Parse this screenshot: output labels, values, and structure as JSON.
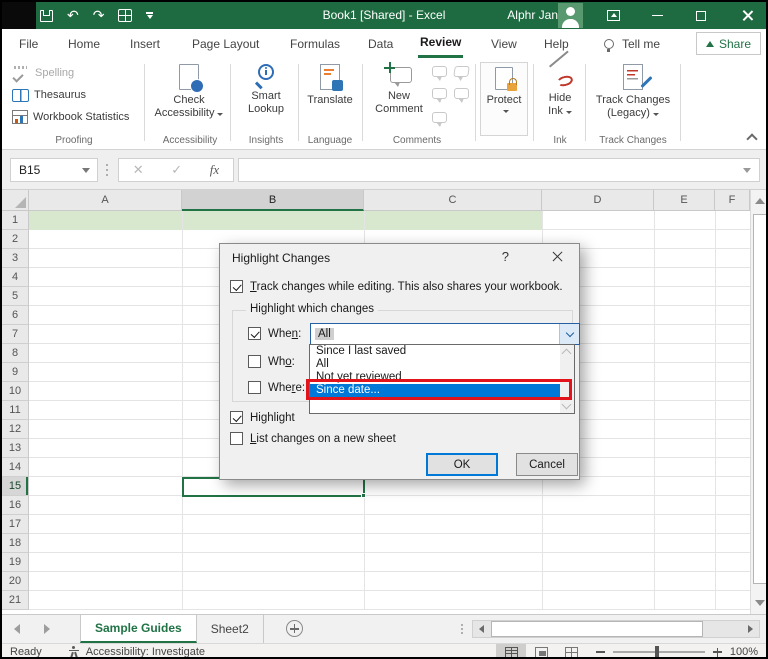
{
  "titlebar": {
    "title": "Book1  [Shared]  -  Excel",
    "user": "Alphr Jan"
  },
  "icons": {
    "undo": "↶",
    "redo": "↷",
    "formula_cancel": "✕",
    "formula_enter": "✓",
    "fx": "fx",
    "dialog_help": "?"
  },
  "ribbon": {
    "tabs": [
      {
        "label": "File"
      },
      {
        "label": "Home"
      },
      {
        "label": "Insert"
      },
      {
        "label": "Page Layout"
      },
      {
        "label": "Formulas"
      },
      {
        "label": "Data"
      },
      {
        "label": "Review",
        "active": true
      },
      {
        "label": "View"
      },
      {
        "label": "Help"
      }
    ],
    "tellme_label": "Tell me",
    "share_label": "Share",
    "groups": {
      "proofing": {
        "label": "Proofing",
        "spelling": "Spelling",
        "thesaurus": "Thesaurus",
        "workbook_statistics": "Workbook Statistics"
      },
      "accessibility": {
        "label": "Accessibility",
        "line1": "Check",
        "line2": "Accessibility"
      },
      "insights": {
        "label": "Insights",
        "line1": "Smart",
        "line2": "Lookup"
      },
      "language": {
        "label": "Language",
        "line1": "Translate"
      },
      "comments": {
        "label": "Comments",
        "line1": "New",
        "line2": "Comment"
      },
      "protect": {
        "line1": "Protect"
      },
      "ink": {
        "label": "Ink",
        "line1": "Hide",
        "line2": "Ink"
      },
      "track_changes": {
        "label": "Track Changes",
        "line1": "Track Changes",
        "line2": "(Legacy)"
      }
    }
  },
  "formula_bar": {
    "name_box": "B15"
  },
  "grid": {
    "columns": [
      "A",
      "B",
      "C",
      "D",
      "E",
      "F"
    ],
    "rows": [
      "1",
      "2",
      "3",
      "4",
      "5",
      "6",
      "7",
      "8",
      "9",
      "10",
      "11",
      "12",
      "13",
      "14",
      "15",
      "16",
      "17",
      "18",
      "19",
      "20",
      "21"
    ],
    "selected_cell": "B15"
  },
  "dialog": {
    "title": "Highlight Changes",
    "track": {
      "key": "T",
      "post": "rack changes while editing. This also shares your workbook."
    },
    "section_label": "Highlight which changes",
    "when": {
      "pre": "Whe",
      "key": "n",
      "post": ":"
    },
    "when_value": "All",
    "who": {
      "pre": "Wh",
      "key": "o",
      "post": ":"
    },
    "where": {
      "pre": "Whe",
      "key": "r",
      "post": "e:"
    },
    "highlight_label": "Highlight",
    "list_sheet": {
      "key": "L",
      "post": "ist changes on a new sheet"
    },
    "ok": "OK",
    "cancel": "Cancel"
  },
  "dropdown": {
    "items": [
      "Since I last saved",
      "All",
      "Not yet reviewed",
      "Since date..."
    ],
    "selected": "Since date..."
  },
  "sheet_tabs": {
    "active": "Sample Guides",
    "other": "Sheet2"
  },
  "status_bar": {
    "ready": "Ready",
    "accessibility": "Accessibility: Investigate",
    "zoom": "100%"
  },
  "colors": {
    "title_green": "#1e6b41",
    "accent_green": "#217346",
    "selection_blue": "#0078d7",
    "annotation_red": "#e3131b",
    "row1_fill": "#d7e8ce"
  }
}
